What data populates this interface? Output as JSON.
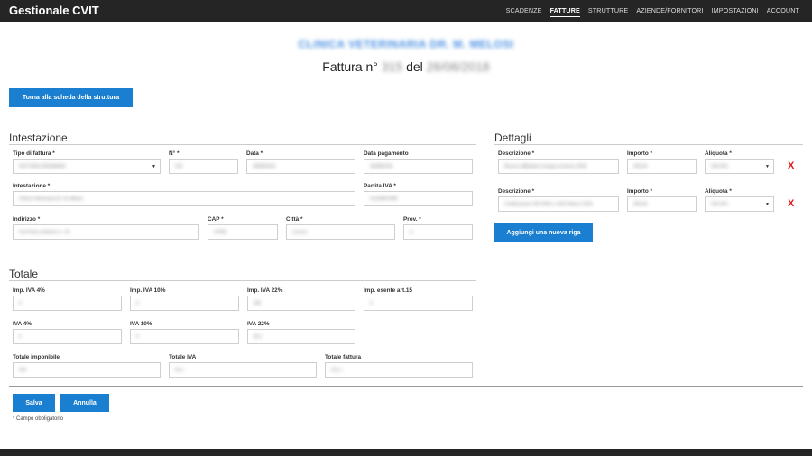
{
  "app": {
    "title": "Gestionale CVIT"
  },
  "nav": {
    "items": [
      "SCADENZE",
      "FATTURE",
      "STRUTTURE",
      "AZIENDE/FORNITORI",
      "IMPOSTAZIONI",
      "ACCOUNT"
    ],
    "active": "FATTURE"
  },
  "header": {
    "clinic_name": "CLINICA VETERINARIA DR. M. MELOSI",
    "invoice_prefix": "Fattura n°",
    "invoice_number": "315",
    "date_prefix": "del",
    "invoice_date": "28/08/2018"
  },
  "back_button": "Torna alla scheda della struttura",
  "intestazione": {
    "heading": "Intestazione",
    "tipo_label": "Tipo di fattura *",
    "tipo_value": "FATTURA ORDINARIA",
    "numero_label": "N° *",
    "numero_value": "315",
    "data_label": "Data *",
    "data_value": "28/08/2018",
    "data_pagamento_label": "Data pagamento",
    "data_pagamento_value": "28/08/2018",
    "intestazione_label": "Intestazione *",
    "intestazione_value": "Clinica Veterinaria Dr. M. Melosi",
    "piva_label": "Partita IVA *",
    "piva_value": "01234567890",
    "indirizzo_label": "Indirizzo *",
    "indirizzo_value": "Via Ponte al Bacino n. 15",
    "cap_label": "CAP *",
    "cap_value": "57000",
    "citta_label": "Città *",
    "citta_value": "Livorno",
    "prov_label": "Prov. *",
    "prov_value": "LI"
  },
  "totale": {
    "heading": "Totale",
    "imp4_label": "Imp. IVA 4%",
    "imp4_value": "0",
    "imp10_label": "Imp. IVA 10%",
    "imp10_value": "0",
    "imp22_label": "Imp. IVA 22%",
    "imp22_value": "255",
    "esente_label": "Imp. esente art.15",
    "esente_value": "0",
    "iva4_label": "IVA 4%",
    "iva4_value": "0",
    "iva10_label": "IVA 10%",
    "iva10_value": "0",
    "iva22_label": "IVA 22%",
    "iva22_value": "56,1",
    "imponibile_label": "Totale imponibile",
    "imponibile_value": "255",
    "totale_iva_label": "Totale IVA",
    "totale_iva_value": "56,1",
    "totale_fattura_label": "Totale fattura",
    "totale_fattura_value": "311,1"
  },
  "dettagli": {
    "heading": "Dettagli",
    "descrizione_label": "Descrizione *",
    "importo_label": "Importo *",
    "aliquota_label": "Aliquota *",
    "rows": [
      {
        "descrizione": "Ricerca affidatario Gruppo di lavoro 2018",
        "importo": "200,00",
        "aliquota": "IVA 22%"
      },
      {
        "descrizione": "Certificazione ISO 9001 e 2015 Marzo 2018",
        "importo": "200,00",
        "aliquota": "IVA 22%"
      }
    ],
    "add_row_button": "Aggiungi una nuova riga"
  },
  "actions": {
    "save": "Salva",
    "cancel": "Annulla"
  },
  "required_note": "* Campo obbligatorio",
  "icons": {
    "delete": "x-icon",
    "dropdown": "caret-down-icon"
  },
  "colors": {
    "topbar": "#252525",
    "primary": "#1a7fd0",
    "delete": "#e01b1b",
    "clinic": "#4a90e2"
  }
}
